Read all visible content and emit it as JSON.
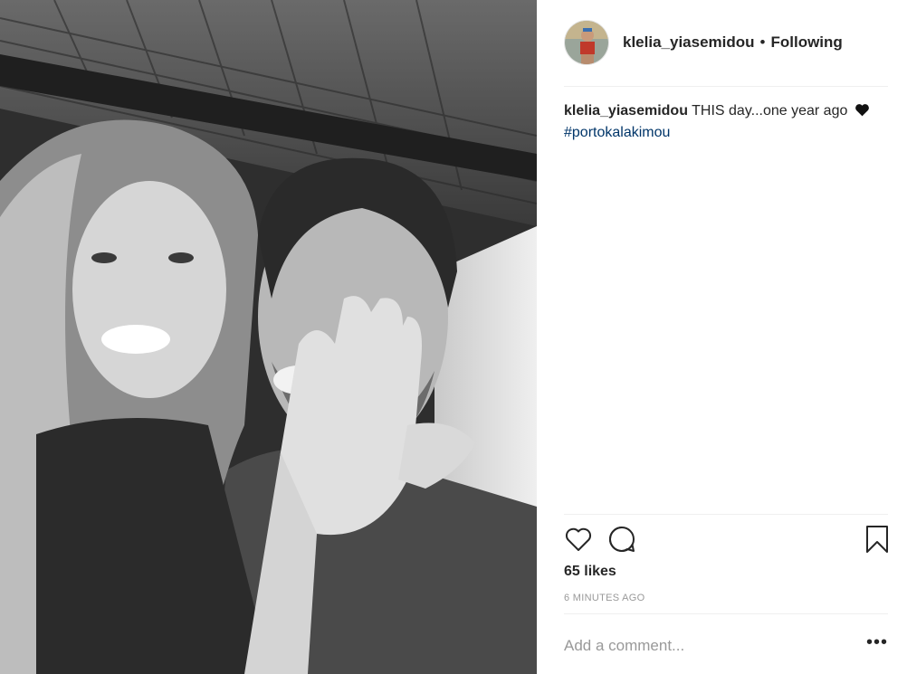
{
  "post": {
    "username": "klelia_yiasemidou",
    "follow_separator": "•",
    "follow_status": "Following",
    "caption": {
      "username": "klelia_yiasemidou",
      "text": "THIS day...one year ago",
      "emoji_icon": "black-heart-icon",
      "hashtag": "#portokalakimou"
    },
    "likes": "65 likes",
    "timestamp": "6 MINUTES AGO",
    "comment_placeholder": "Add a comment...",
    "more_options": "•••"
  },
  "icons": {
    "like": "heart-outline-icon",
    "comment": "speech-bubble-icon",
    "save": "bookmark-icon",
    "more": "ellipsis-icon"
  },
  "colors": {
    "text": "#262626",
    "muted": "#999999",
    "hashtag": "#003569",
    "divider": "#efefef"
  }
}
